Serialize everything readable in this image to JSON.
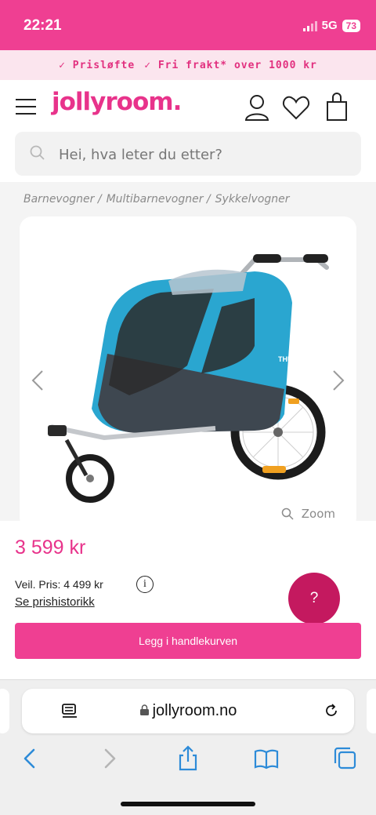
{
  "status": {
    "time": "22:21",
    "network": "5G",
    "battery": "73"
  },
  "promo": {
    "items": [
      "✓ Prisløfte",
      "✓ Fri frakt* over 1000 kr"
    ]
  },
  "header": {
    "logo": "jollyroom."
  },
  "search": {
    "placeholder": "Hei, hva leter du etter?"
  },
  "breadcrumb": {
    "items": [
      "Barnevogner /",
      "Multibarnevogner /",
      "Sykkelvogner"
    ]
  },
  "product": {
    "image_brand": "THULE",
    "zoom_label": "Zoom",
    "price": "3 599 kr",
    "recommended_price": "Veil. Pris: 4 499 kr",
    "info_symbol": "i",
    "price_history_link": "Se prishistorikk",
    "add_to_cart": "Legg i handlekurven"
  },
  "help": {
    "label": "?"
  },
  "browser": {
    "url": "jollyroom.no"
  },
  "colors": {
    "brand": "#ef3f92",
    "brand_dark": "#c4195f",
    "accent_blue": "#2d8bd8"
  }
}
